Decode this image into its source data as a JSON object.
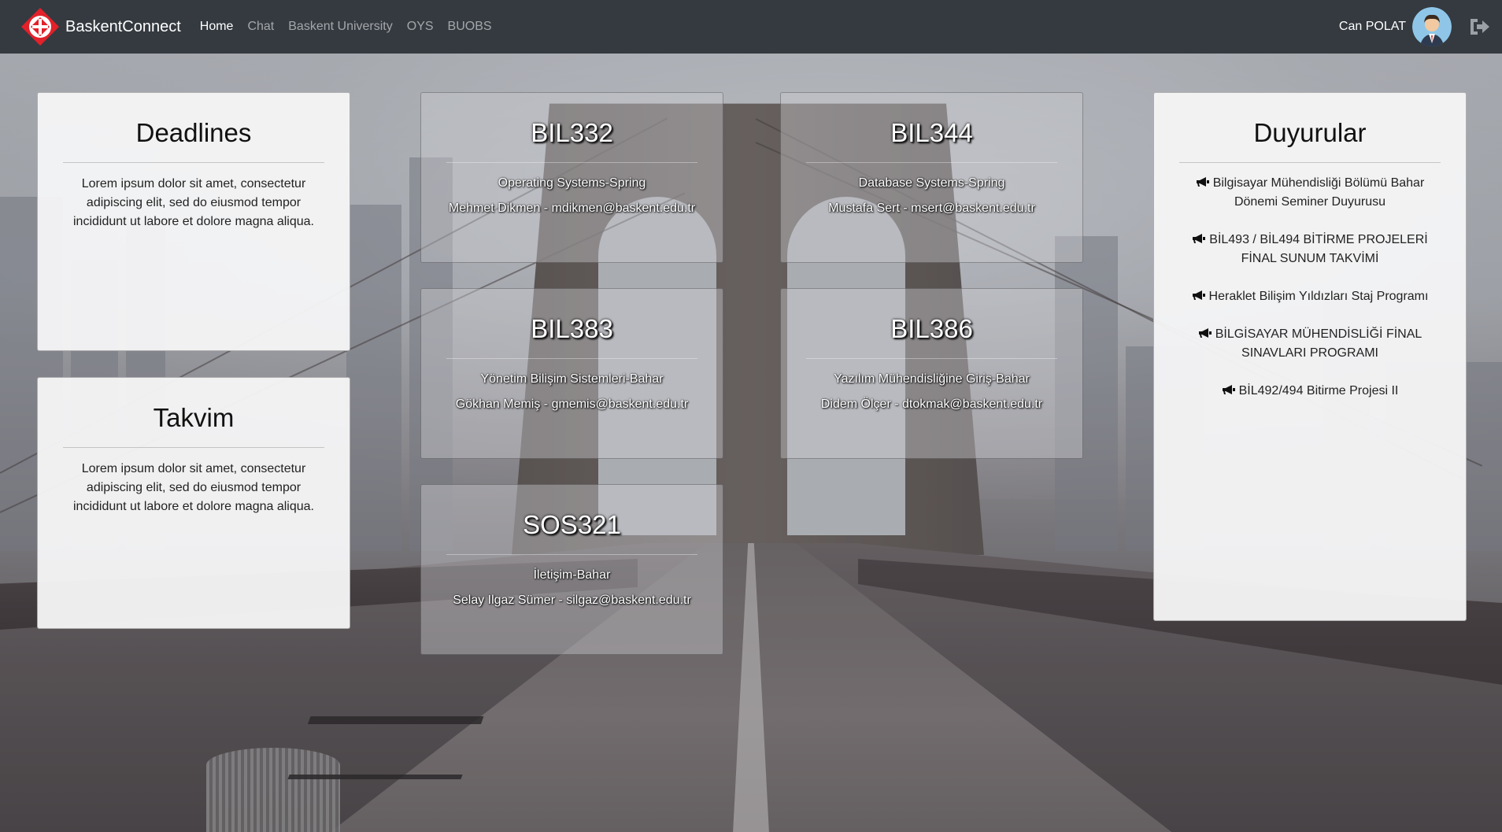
{
  "navbar": {
    "brand": "BaskentConnect",
    "links": [
      {
        "label": "Home"
      },
      {
        "label": "Chat"
      },
      {
        "label": "Baskent University"
      },
      {
        "label": "OYS"
      },
      {
        "label": "BUOBS"
      }
    ],
    "user_name": "Can POLAT"
  },
  "deadlines": {
    "title": "Deadlines",
    "text": "Lorem ipsum dolor sit amet, consectetur adipiscing elit, sed do eiusmod tempor incididunt ut labore et dolore magna aliqua."
  },
  "calendar": {
    "title": "Takvim",
    "text": "Lorem ipsum dolor sit amet, consectetur adipiscing elit, sed do eiusmod tempor incididunt ut labore et dolore magna aliqua."
  },
  "courses": [
    {
      "code": "BIL332",
      "name": "Operating Systems-Spring",
      "instructor": "Mehmet Dikmen - mdikmen@baskent.edu.tr"
    },
    {
      "code": "BIL344",
      "name": "Database Systems-Spring",
      "instructor": "Mustafa Sert - msert@baskent.edu.tr"
    },
    {
      "code": "BIL383",
      "name": "Yönetim Bilişim Sistemleri-Bahar",
      "instructor": "Gökhan Memiş - gmemis@baskent.edu.tr"
    },
    {
      "code": "BIL386",
      "name": "Yazılım Mühendisliğine Giriş-Bahar",
      "instructor": "Didem Ölçer - dtokmak@baskent.edu.tr"
    },
    {
      "code": "SOS321",
      "name": "İletişim-Bahar",
      "instructor": "Selay Ilgaz Sümer - silgaz@baskent.edu.tr"
    }
  ],
  "announcements": {
    "title": "Duyurular",
    "items": [
      "Bilgisayar Mühendisliği Bölümü Bahar Dönemi Seminer Duyurusu",
      "BİL493 / BİL494 BİTİRME PROJELERİ FİNAL SUNUM TAKVİMİ",
      "Heraklet Bilişim Yıldızları Staj Programı",
      "BİLGİSAYAR MÜHENDİSLİĞİ FİNAL SINAVLARI PROGRAMI",
      "BİL492/494 Bitirme Projesi II"
    ]
  },
  "icons": {
    "logo": "baskent-logo-icon",
    "avatar": "user-avatar-icon",
    "logout": "sign-out-icon",
    "announcement": "bullhorn-icon"
  },
  "colors": {
    "navbar": "#343a40",
    "logo_red": "#e2212a"
  }
}
